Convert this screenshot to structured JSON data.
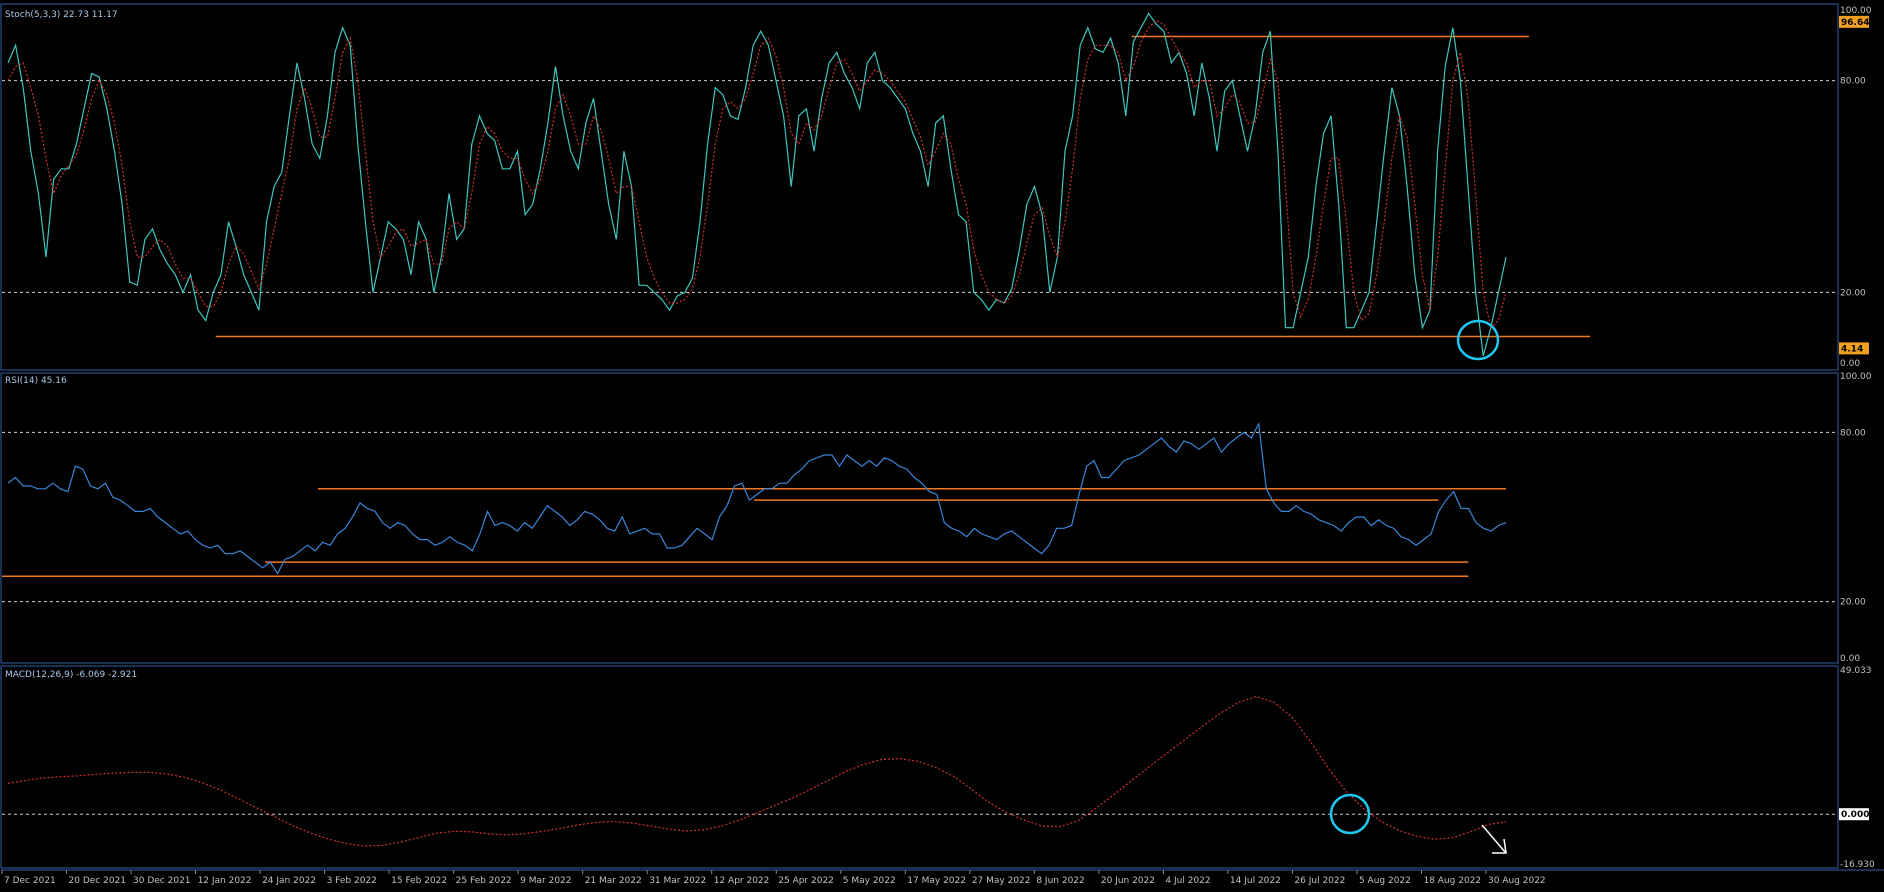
{
  "chart_data": [
    {
      "type": "line",
      "panel": "stochastic",
      "title": "Stoch(5,3,3) 22.73 11.17",
      "ylim": [
        0,
        100
      ],
      "ticks": [
        "100.00",
        "80.00",
        "20.00",
        "0.00"
      ],
      "badges": [
        {
          "text": "96.64",
          "value": 96.64
        },
        {
          "text": "4.14",
          "value": 4.14
        }
      ],
      "grid_levels": [
        80,
        20
      ],
      "series": [
        {
          "name": "%K",
          "color": "#3ec6c0",
          "values": [
            85,
            90,
            78,
            60,
            48,
            30,
            52,
            55,
            55,
            62,
            72,
            82,
            81,
            72,
            60,
            45,
            23,
            22,
            35,
            38,
            32,
            28,
            25,
            20,
            25,
            15,
            12,
            20,
            25,
            40,
            33,
            25,
            20,
            15,
            40,
            50,
            54,
            70,
            85,
            75,
            62,
            58,
            70,
            88,
            95,
            90,
            62,
            40,
            20,
            30,
            40,
            38,
            35,
            25,
            40,
            35,
            20,
            30,
            48,
            35,
            38,
            62,
            70,
            65,
            63,
            55,
            55,
            60,
            42,
            45,
            55,
            68,
            84,
            70,
            60,
            55,
            68,
            75,
            60,
            45,
            35,
            60,
            50,
            22,
            22,
            20,
            18,
            15,
            19,
            20,
            24,
            40,
            62,
            78,
            76,
            70,
            69,
            78,
            90,
            94,
            90,
            80,
            70,
            50,
            70,
            72,
            60,
            75,
            85,
            88,
            82,
            78,
            72,
            85,
            88,
            80,
            78,
            75,
            72,
            65,
            60,
            50,
            68,
            70,
            55,
            42,
            40,
            20,
            18,
            15,
            18,
            17,
            21,
            32,
            45,
            50,
            42,
            20,
            30,
            60,
            70,
            90,
            95,
            89,
            88,
            92,
            85,
            70,
            91,
            95,
            99,
            96,
            94,
            85,
            88,
            82,
            70,
            85,
            75,
            60,
            77,
            80,
            70,
            60,
            70,
            88,
            94,
            60,
            10,
            10,
            20,
            30,
            50,
            65,
            70,
            45,
            10,
            10,
            15,
            20,
            40,
            60,
            78,
            70,
            50,
            25,
            10,
            15,
            60,
            84,
            95,
            80,
            50,
            20,
            2,
            10,
            20,
            30
          ]
        },
        {
          "name": "%D",
          "color": "#d03030",
          "values": [
            80,
            84,
            85,
            78,
            70,
            58,
            48,
            53,
            56,
            59,
            66,
            75,
            80,
            76,
            68,
            56,
            40,
            30,
            30,
            33,
            35,
            33,
            28,
            24,
            24,
            20,
            16,
            16,
            20,
            28,
            33,
            31,
            26,
            21,
            28,
            38,
            48,
            58,
            72,
            78,
            72,
            64,
            64,
            75,
            88,
            92,
            80,
            60,
            40,
            30,
            33,
            37,
            38,
            33,
            34,
            35,
            28,
            28,
            38,
            40,
            38,
            48,
            62,
            67,
            65,
            60,
            58,
            58,
            52,
            48,
            52,
            60,
            72,
            76,
            70,
            62,
            62,
            70,
            66,
            58,
            48,
            50,
            50,
            40,
            30,
            24,
            20,
            17,
            17,
            18,
            21,
            30,
            45,
            62,
            72,
            74,
            72,
            75,
            82,
            90,
            92,
            87,
            78,
            65,
            62,
            68,
            66,
            70,
            78,
            85,
            86,
            82,
            77,
            80,
            83,
            82,
            80,
            77,
            74,
            69,
            64,
            56,
            60,
            65,
            62,
            52,
            45,
            32,
            25,
            20,
            18,
            17,
            19,
            25,
            34,
            42,
            44,
            36,
            30,
            40,
            55,
            75,
            86,
            90,
            90,
            90,
            88,
            80,
            84,
            91,
            95,
            97,
            96,
            92,
            88,
            85,
            78,
            80,
            80,
            70,
            72,
            76,
            74,
            68,
            68,
            76,
            86,
            80,
            50,
            20,
            13,
            18,
            30,
            45,
            58,
            58,
            40,
            20,
            12,
            14,
            25,
            40,
            58,
            70,
            64,
            45,
            25,
            15,
            30,
            55,
            80,
            88,
            75,
            48,
            20,
            10,
            12,
            20
          ]
        }
      ],
      "annotations": {
        "horizontal_lines": [
          {
            "value": 92.5,
            "x_start": 148,
            "x_end": 200
          },
          {
            "value": 7.5,
            "x_start": 28,
            "x_end": 208
          }
        ]
      }
    },
    {
      "type": "line",
      "panel": "rsi",
      "title": "RSI(14) 45.16",
      "ylim": [
        0,
        100
      ],
      "ticks": [
        "100.00",
        "80.00",
        "20.00",
        "0.00"
      ],
      "grid_levels": [
        80,
        20
      ],
      "series": [
        {
          "name": "RSI",
          "color": "#3a86d8",
          "values": [
            62,
            64,
            61,
            61,
            60,
            60,
            62,
            60,
            59,
            68,
            67,
            61,
            60,
            62,
            57,
            56,
            54,
            52,
            52,
            53,
            50,
            48,
            46,
            44,
            45,
            42,
            40,
            39,
            40,
            37,
            37,
            38,
            36,
            34,
            32,
            34,
            30,
            35,
            36,
            38,
            40,
            38,
            41,
            40,
            44,
            46,
            50,
            55,
            53,
            52,
            48,
            46,
            48,
            47,
            44,
            42,
            42,
            40,
            41,
            43,
            41,
            40,
            38,
            44,
            52,
            47,
            48,
            47,
            45,
            48,
            46,
            50,
            54,
            52,
            50,
            47,
            49,
            52,
            51,
            49,
            46,
            45,
            50,
            44,
            45,
            46,
            44,
            44,
            39,
            39,
            40,
            43,
            46,
            44,
            42,
            50,
            54,
            61,
            62,
            56,
            58,
            60,
            60,
            62,
            62,
            65,
            67,
            70,
            71,
            72,
            72,
            68,
            72,
            70,
            68,
            70,
            68,
            71,
            70,
            68,
            67,
            64,
            62,
            59,
            58,
            48,
            46,
            45,
            43,
            46,
            44,
            43,
            42,
            44,
            45,
            43,
            41,
            39,
            37,
            40,
            46,
            46,
            47,
            58,
            68,
            70,
            64,
            64,
            67,
            70,
            71,
            72,
            74,
            76,
            78,
            75,
            73,
            77,
            76,
            74,
            76,
            78,
            73,
            76,
            78,
            80,
            78,
            83,
            60,
            55,
            52,
            52,
            54,
            52,
            51,
            49,
            48,
            47,
            45,
            48,
            50,
            50,
            47,
            49,
            47,
            46,
            43,
            42,
            40,
            42,
            44,
            52,
            56,
            59,
            53,
            53,
            48,
            46,
            45,
            47,
            48
          ]
        }
      ],
      "annotations": {
        "horizontal_lines": [
          {
            "value": 60,
            "x_start": 42,
            "x_end": 200
          },
          {
            "value": 56,
            "x_start": 100,
            "x_end": 191
          },
          {
            "value": 34,
            "x_start": 35,
            "x_end": 195
          },
          {
            "value": 29,
            "x_start": 0,
            "x_end": 195
          }
        ]
      }
    },
    {
      "type": "line",
      "panel": "macd",
      "title": "MACD(12,26,9) -6.069 -2.921",
      "ylim": [
        -16.93,
        49.033
      ],
      "ticks": [
        "49.033",
        "0.000",
        "-16.930"
      ],
      "badges": [
        {
          "text": "0.000",
          "value": 0
        }
      ],
      "grid_levels": [
        0
      ],
      "series": [
        {
          "name": "Signal",
          "color": "#d03030",
          "values": [
            10.5,
            11.5,
            12.3,
            12.8,
            13.1,
            13.6,
            14,
            14.2,
            14.2,
            13.6,
            12.4,
            10.5,
            8,
            5,
            2,
            -1,
            -4,
            -6.5,
            -8.5,
            -10,
            -10.8,
            -10.6,
            -9.5,
            -8,
            -6.5,
            -5.8,
            -6,
            -6.7,
            -7,
            -6.6,
            -5.8,
            -4.8,
            -3.6,
            -2.8,
            -2.5,
            -3,
            -4,
            -5,
            -5.7,
            -5.3,
            -4,
            -2,
            0.4,
            3,
            5.5,
            8.5,
            11.5,
            14.6,
            17,
            18.6,
            18.9,
            18,
            16,
            13,
            8.6,
            4,
            0.5,
            -2,
            -4,
            -4.2,
            -2.2,
            2,
            6.6,
            11.4,
            16.2,
            20.8,
            25.4,
            30,
            34.4,
            38,
            40,
            38,
            33,
            25,
            16,
            8,
            2,
            -2.5,
            -5.5,
            -7.5,
            -8.5,
            -8,
            -6,
            -3.5,
            -2.5
          ]
        }
      ]
    }
  ],
  "x_axis": {
    "labels": [
      "7 Dec 2021",
      "20 Dec 2021",
      "30 Dec 2021",
      "12 Jan 2022",
      "24 Jan 2022",
      "3 Feb 2022",
      "15 Feb 2022",
      "25 Feb 2022",
      "9 Mar 2022",
      "21 Mar 2022",
      "31 Mar 2022",
      "12 Apr 2022",
      "25 Apr 2022",
      "5 May 2022",
      "17 May 2022",
      "27 May 2022",
      "8 Jun 2022",
      "20 Jun 2022",
      "4 Jul 2022",
      "14 Jul 2022",
      "26 Jul 2022",
      "5 Aug 2022",
      "18 Aug 2022",
      "30 Aug 2022"
    ]
  },
  "highlights": [
    {
      "panel": "stochastic",
      "shape": "circle",
      "color": "#1ec8f0"
    },
    {
      "panel": "macd",
      "shape": "circle",
      "color": "#1ec8f0"
    },
    {
      "panel": "macd",
      "shape": "arrow",
      "direction": "down-right",
      "color": "#ffffff"
    }
  ],
  "colors": {
    "annotation_line": "#f07820",
    "panel_border": "#3060a8",
    "grid": "#d0d0d0",
    "badge_orange": "#f0a020"
  }
}
